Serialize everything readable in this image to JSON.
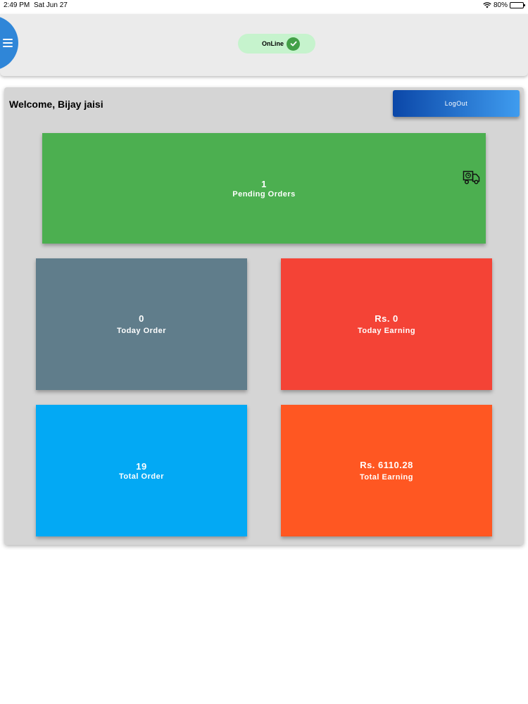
{
  "status_bar": {
    "time": "2:49 PM",
    "date": "Sat Jun 27",
    "battery": "80%",
    "battery_level": 0.8
  },
  "app_bar": {
    "status_label": "OnLine",
    "status_color": "#43a047",
    "menu_color": "#2f86d8"
  },
  "main": {
    "welcome": "Welcome, Bijay jaisi",
    "logout_label": "LogOut",
    "cards": {
      "pending": {
        "value": "1",
        "label": "Pending Orders",
        "color": "#4caf50"
      },
      "today_order": {
        "value": "0",
        "label": "Today Order",
        "color": "#607d8b"
      },
      "today_earning": {
        "value": "Rs. 0",
        "label": "Today Earning",
        "color": "#f44336"
      },
      "total_order": {
        "value": "19",
        "label": "Total Order",
        "color": "#03a9f4"
      },
      "total_earning": {
        "value": "Rs. 6110.28",
        "label": "Total Earning",
        "color": "#ff5722"
      }
    }
  },
  "icons": [
    "wifi-icon",
    "battery-icon",
    "menu-icon",
    "check-icon",
    "truck-icon"
  ]
}
